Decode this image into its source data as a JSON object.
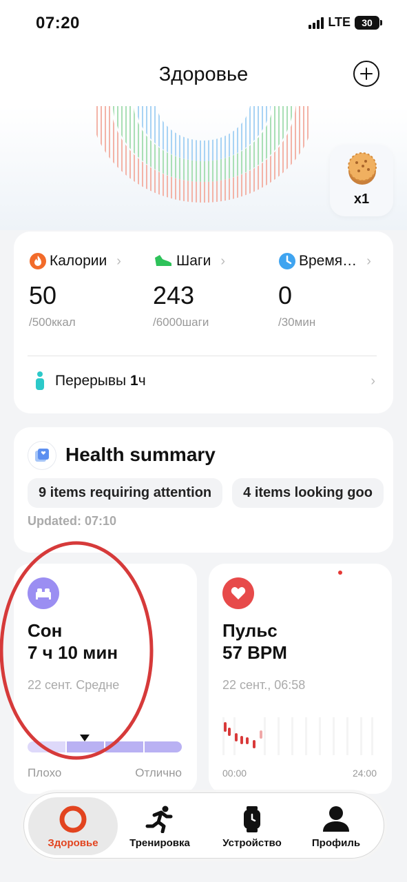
{
  "status_bar": {
    "time": "07:20",
    "network": "LTE",
    "battery": "30"
  },
  "header": {
    "title": "Здоровье"
  },
  "reward": {
    "count": "x1",
    "icon": "cookie-icon"
  },
  "activity": {
    "metrics": [
      {
        "label": "Калории",
        "value": "50",
        "goal": "/500ккал",
        "icon": "flame-icon",
        "color": "#f26b2a"
      },
      {
        "label": "Шаги",
        "value": "243",
        "goal": "/6000шаги",
        "icon": "shoe-icon",
        "color": "#2ec25a"
      },
      {
        "label": "Время…",
        "value": "0",
        "goal": "/30мин",
        "icon": "clock-icon",
        "color": "#3fa4f0"
      }
    ],
    "breaks": {
      "label": "Перерывы",
      "value": "1",
      "unit": "ч",
      "icon": "standing-person-icon"
    }
  },
  "health_summary": {
    "title": "Health summary",
    "chips": [
      "9 items requiring attention",
      "4 items looking goo"
    ],
    "updated": "Updated: 07:10"
  },
  "sleep": {
    "title": "Сон",
    "value": "7 ч 10 мин",
    "subtitle": "22 сент. Средне",
    "low_label": "Плохо",
    "high_label": "Отлично",
    "icon_color": "#9b8ef2"
  },
  "pulse": {
    "title": "Пульс",
    "value": "57 BPM",
    "subtitle": "22 сент., 06:58",
    "time_start": "00:00",
    "time_end": "24:00",
    "icon_color": "#e74a4a"
  },
  "tabs": [
    {
      "label": "Здоровье",
      "icon": "ring-icon",
      "active": true
    },
    {
      "label": "Тренировка",
      "icon": "running-icon",
      "active": false
    },
    {
      "label": "Устройство",
      "icon": "watch-icon",
      "active": false
    },
    {
      "label": "Профиль",
      "icon": "person-icon",
      "active": false
    }
  ],
  "colors": {
    "accent": "#e2441f",
    "annotation": "#d63a3a"
  }
}
